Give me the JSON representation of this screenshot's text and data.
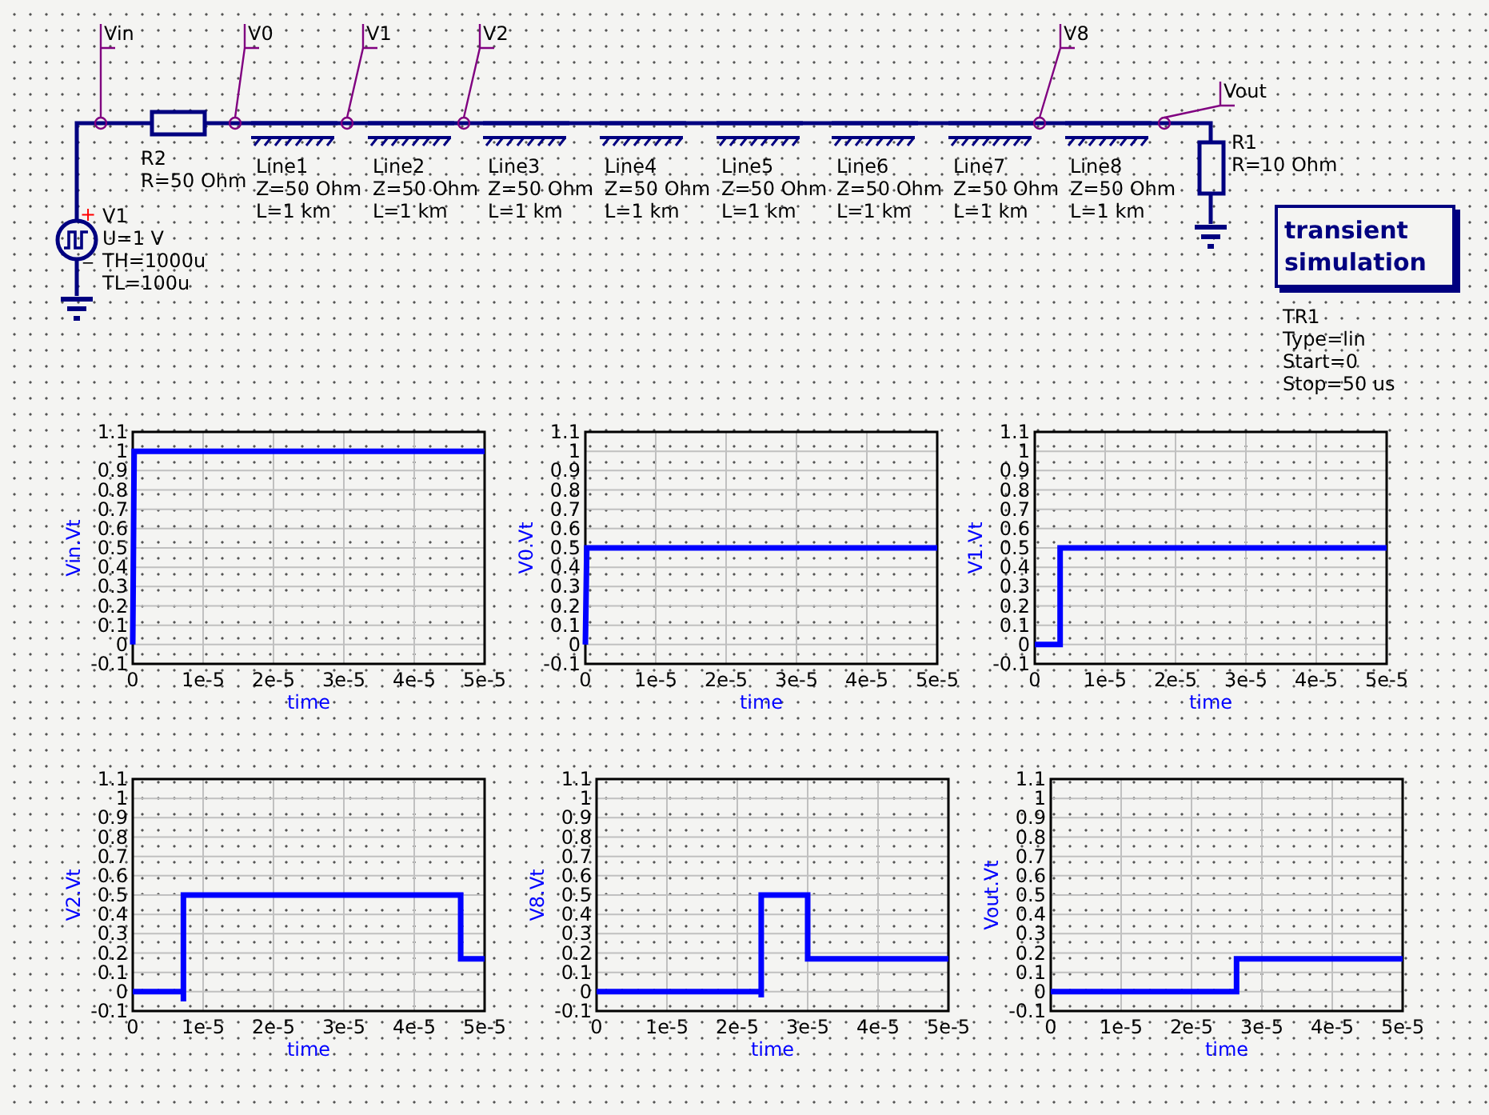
{
  "schematic": {
    "probes": [
      {
        "label": "Vin"
      },
      {
        "label": "V0"
      },
      {
        "label": "V1"
      },
      {
        "label": "V2"
      },
      {
        "label": "V8"
      },
      {
        "label": "Vout"
      }
    ],
    "source": {
      "name": "V1",
      "plus": "+",
      "minus": "_",
      "params": [
        "U=1 V",
        "TH=1000u",
        "TL=100u"
      ]
    },
    "resistors": [
      {
        "name": "R2",
        "value": "R=50 Ohm"
      },
      {
        "name": "R1",
        "value": "R=10 Ohm"
      }
    ],
    "lines": [
      {
        "name": "Line1",
        "z": "Z=50 Ohm",
        "l": "L=1 km"
      },
      {
        "name": "Line2",
        "z": "Z=50 Ohm",
        "l": "L=1 km"
      },
      {
        "name": "Line3",
        "z": "Z=50 Ohm",
        "l": "L=1 km"
      },
      {
        "name": "Line4",
        "z": "Z=50 Ohm",
        "l": "L=1 km"
      },
      {
        "name": "Line5",
        "z": "Z=50 Ohm",
        "l": "L=1 km"
      },
      {
        "name": "Line6",
        "z": "Z=50 Ohm",
        "l": "L=1 km"
      },
      {
        "name": "Line7",
        "z": "Z=50 Ohm",
        "l": "L=1 km"
      },
      {
        "name": "Line8",
        "z": "Z=50 Ohm",
        "l": "L=1 km"
      }
    ],
    "simulation": {
      "title": [
        "transient",
        "simulation"
      ],
      "name": "TR1",
      "params": [
        "Type=lin",
        "Start=0",
        "Stop=50 us"
      ]
    }
  },
  "charts": [
    {
      "chart_data": {
        "type": "line",
        "xlabel": "time",
        "xlim": [
          0,
          5e-05
        ],
        "ylim": [
          -0.1,
          1.1
        ],
        "x": [
          0,
          2e-07,
          5e-05
        ],
        "series": [
          {
            "name": "Vin.Vt",
            "color": "#0000ff",
            "values": [
              0,
              1,
              1
            ]
          }
        ],
        "grid": true,
        "xticks": [
          {
            "value": 0,
            "label": "0"
          },
          {
            "value": 1e-05,
            "label": "1e-5"
          },
          {
            "value": 2e-05,
            "label": "2e-5"
          },
          {
            "value": 3e-05,
            "label": "3e-5"
          },
          {
            "value": 4e-05,
            "label": "4e-5"
          },
          {
            "value": 5e-05,
            "label": "5e-5"
          }
        ],
        "yticks": [
          -0.1,
          0,
          0.1,
          0.2,
          0.3,
          0.4,
          0.5,
          0.6,
          0.7,
          0.8,
          0.9,
          1,
          1.1
        ]
      }
    },
    {
      "chart_data": {
        "type": "line",
        "xlabel": "time",
        "xlim": [
          0,
          5e-05
        ],
        "ylim": [
          -0.1,
          1.1
        ],
        "x": [
          0,
          2e-07,
          5e-05
        ],
        "series": [
          {
            "name": "V0.Vt",
            "color": "#0000ff",
            "values": [
              0,
              0.5,
              0.5
            ]
          }
        ],
        "grid": true,
        "xticks": [
          {
            "value": 0,
            "label": "0"
          },
          {
            "value": 1e-05,
            "label": "1e-5"
          },
          {
            "value": 2e-05,
            "label": "2e-5"
          },
          {
            "value": 3e-05,
            "label": "3e-5"
          },
          {
            "value": 4e-05,
            "label": "4e-5"
          },
          {
            "value": 5e-05,
            "label": "5e-5"
          }
        ],
        "yticks": [
          -0.1,
          0,
          0.1,
          0.2,
          0.3,
          0.4,
          0.5,
          0.6,
          0.7,
          0.8,
          0.9,
          1,
          1.1
        ]
      }
    },
    {
      "chart_data": {
        "type": "line",
        "xlabel": "time",
        "xlim": [
          0,
          5e-05
        ],
        "ylim": [
          -0.1,
          1.1
        ],
        "x": [
          0,
          3.6e-06,
          3.6e-06,
          5e-05
        ],
        "series": [
          {
            "name": "V1.Vt",
            "color": "#0000ff",
            "values": [
              0,
              0,
              0.5,
              0.5
            ]
          }
        ],
        "grid": true,
        "xticks": [
          {
            "value": 0,
            "label": "0"
          },
          {
            "value": 1e-05,
            "label": "1e-5"
          },
          {
            "value": 2e-05,
            "label": "2e-5"
          },
          {
            "value": 3e-05,
            "label": "3e-5"
          },
          {
            "value": 4e-05,
            "label": "4e-5"
          },
          {
            "value": 5e-05,
            "label": "5e-5"
          }
        ],
        "yticks": [
          -0.1,
          0,
          0.1,
          0.2,
          0.3,
          0.4,
          0.5,
          0.6,
          0.7,
          0.8,
          0.9,
          1,
          1.1
        ]
      }
    },
    {
      "chart_data": {
        "type": "line",
        "xlabel": "time",
        "xlim": [
          0,
          5e-05
        ],
        "ylim": [
          -0.1,
          1.1
        ],
        "x": [
          0,
          7.2e-06,
          7.2e-06,
          7.2e-06,
          4.66e-05,
          4.66e-05,
          5e-05
        ],
        "series": [
          {
            "name": "V2.Vt",
            "color": "#0000ff",
            "values": [
              0,
              0,
              -0.05,
              0.5,
              0.5,
              0.17,
              0.17
            ]
          }
        ],
        "grid": true,
        "xticks": [
          {
            "value": 0,
            "label": "0"
          },
          {
            "value": 1e-05,
            "label": "1e-5"
          },
          {
            "value": 2e-05,
            "label": "2e-5"
          },
          {
            "value": 3e-05,
            "label": "3e-5"
          },
          {
            "value": 4e-05,
            "label": "4e-5"
          },
          {
            "value": 5e-05,
            "label": "5e-5"
          }
        ],
        "yticks": [
          -0.1,
          0,
          0.1,
          0.2,
          0.3,
          0.4,
          0.5,
          0.6,
          0.7,
          0.8,
          0.9,
          1,
          1.1
        ]
      }
    },
    {
      "chart_data": {
        "type": "line",
        "xlabel": "time",
        "xlim": [
          0,
          5e-05
        ],
        "ylim": [
          -0.1,
          1.1
        ],
        "x": [
          0,
          2.34e-05,
          2.34e-05,
          2.34e-05,
          3e-05,
          3e-05,
          5e-05
        ],
        "series": [
          {
            "name": "V8.Vt",
            "color": "#0000ff",
            "values": [
              0,
              0,
              -0.03,
              0.5,
              0.5,
              0.17,
              0.17
            ]
          }
        ],
        "grid": true,
        "xticks": [
          {
            "value": 0,
            "label": "0"
          },
          {
            "value": 1e-05,
            "label": "1e-5"
          },
          {
            "value": 2e-05,
            "label": "2e-5"
          },
          {
            "value": 3e-05,
            "label": "3e-5"
          },
          {
            "value": 4e-05,
            "label": "4e-5"
          },
          {
            "value": 5e-05,
            "label": "5e-5"
          }
        ],
        "yticks": [
          -0.1,
          0,
          0.1,
          0.2,
          0.3,
          0.4,
          0.5,
          0.6,
          0.7,
          0.8,
          0.9,
          1,
          1.1
        ]
      }
    },
    {
      "chart_data": {
        "type": "line",
        "xlabel": "time",
        "xlim": [
          0,
          5e-05
        ],
        "ylim": [
          -0.1,
          1.1
        ],
        "x": [
          0,
          2.64e-05,
          2.64e-05,
          5e-05
        ],
        "series": [
          {
            "name": "Vout.Vt",
            "color": "#0000ff",
            "values": [
              0,
              0,
              0.17,
              0.17
            ]
          }
        ],
        "grid": true,
        "xticks": [
          {
            "value": 0,
            "label": "0"
          },
          {
            "value": 1e-05,
            "label": "1e-5"
          },
          {
            "value": 2e-05,
            "label": "2e-5"
          },
          {
            "value": 3e-05,
            "label": "3e-5"
          },
          {
            "value": 4e-05,
            "label": "4e-5"
          },
          {
            "value": 5e-05,
            "label": "5e-5"
          }
        ],
        "yticks": [
          -0.1,
          0,
          0.1,
          0.2,
          0.3,
          0.4,
          0.5,
          0.6,
          0.7,
          0.8,
          0.9,
          1,
          1.1
        ]
      }
    }
  ]
}
